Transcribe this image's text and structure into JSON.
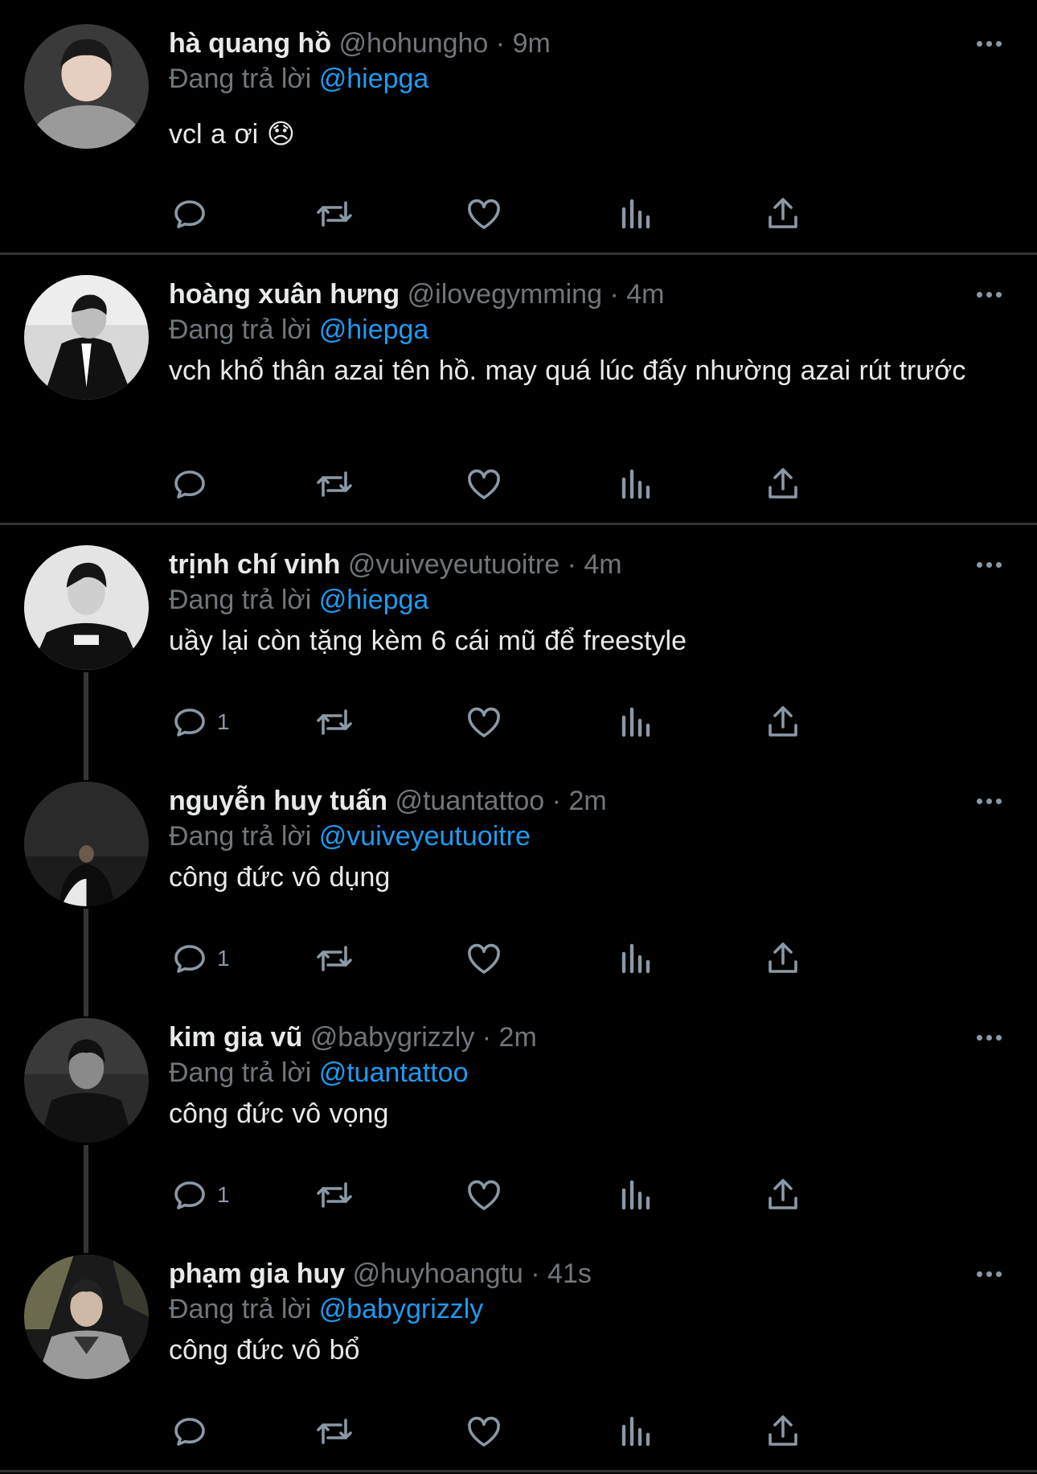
{
  "reply_prefix": "Đang trả lời",
  "colors": {
    "background": "#000000",
    "text": "#e7e9ea",
    "muted": "#71767b",
    "link": "#1d9bf0",
    "icon": "#8b98a5"
  },
  "icons": [
    "reply-icon",
    "retweet-icon",
    "like-icon",
    "views-icon",
    "share-icon",
    "more-icon"
  ],
  "tweets": [
    {
      "name": "hà quang hồ",
      "handle": "@hohungho",
      "time": "· 9m",
      "reply_to": "@hiepga",
      "text": "vcl a ơi 😞",
      "reply_count": ""
    },
    {
      "name": "hoàng xuân hưng",
      "handle": "@ilovegymming",
      "time": "· 4m",
      "reply_to": "@hiepga",
      "text": "vch khổ thân azai tên hồ. may quá lúc đấy nhường azai rút trước",
      "reply_count": ""
    },
    {
      "name": "trịnh chí vinh",
      "handle": "@vuiveyeutuoitre",
      "time": "· 4m",
      "reply_to": "@hiepga",
      "text": "uầy lại còn tặng kèm 6 cái mũ để freestyle",
      "reply_count": "1"
    },
    {
      "name": "nguyễn huy tuấn",
      "handle": "@tuantattoo",
      "time": "· 2m",
      "reply_to": "@vuiveyeutuoitre",
      "text": "công đức vô dụng",
      "reply_count": "1"
    },
    {
      "name": "kim gia vũ",
      "handle": "@babygrizzly",
      "time": "· 2m",
      "reply_to": "@tuantattoo",
      "text": "công đức vô vọng",
      "reply_count": "1"
    },
    {
      "name": "phạm gia huy",
      "handle": "@huyhoangtu",
      "time": "· 41s",
      "reply_to": "@babygrizzly",
      "text": "công đức vô bổ",
      "reply_count": ""
    }
  ]
}
